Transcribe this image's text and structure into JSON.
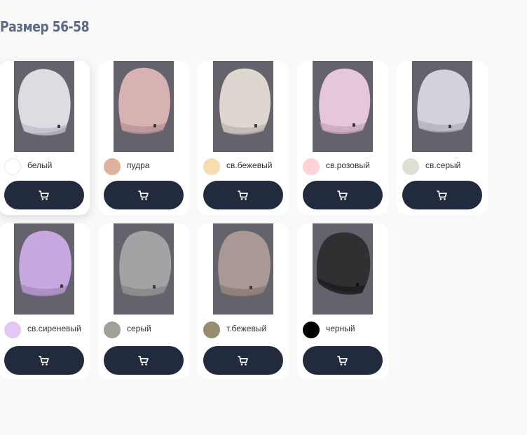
{
  "page": {
    "title": "Размер 56-58"
  },
  "products": [
    {
      "color_name": "белый",
      "swatch": "#ffffff",
      "hat": "#dcdce2",
      "hat_shadow": "#bfc0c8"
    },
    {
      "color_name": "пудра",
      "swatch": "#deb29a",
      "hat": "#d8b1b3",
      "hat_shadow": "#b99396"
    },
    {
      "color_name": "св.бежевый",
      "swatch": "#f6dcb0",
      "hat": "#ddd7d0",
      "hat_shadow": "#bdb6af"
    },
    {
      "color_name": "св.розовый",
      "swatch": "#ffd2d7",
      "hat": "#e6c6d9",
      "hat_shadow": "#c9a6bc"
    },
    {
      "color_name": "св.серый",
      "swatch": "#dfdfd6",
      "hat": "#d2d2da",
      "hat_shadow": "#b3b3bd"
    },
    {
      "color_name": "св.сиреневый",
      "swatch": "#e6c6f5",
      "hat": "#c7a7df",
      "hat_shadow": "#a789c1"
    },
    {
      "color_name": "серый",
      "swatch": "#a1a19a",
      "hat": "#a3a3a6",
      "hat_shadow": "#86868a"
    },
    {
      "color_name": "т.бежевый",
      "swatch": "#978b70",
      "hat": "#a99893",
      "hat_shadow": "#8b7b77"
    },
    {
      "color_name": "черный",
      "swatch": "#000000",
      "hat": "#303032",
      "hat_shadow": "#1c1c1e"
    }
  ],
  "ui": {
    "cart_icon": "shopping-cart-icon",
    "button_color": "#222a3d",
    "title_color": "#5f6a86"
  }
}
